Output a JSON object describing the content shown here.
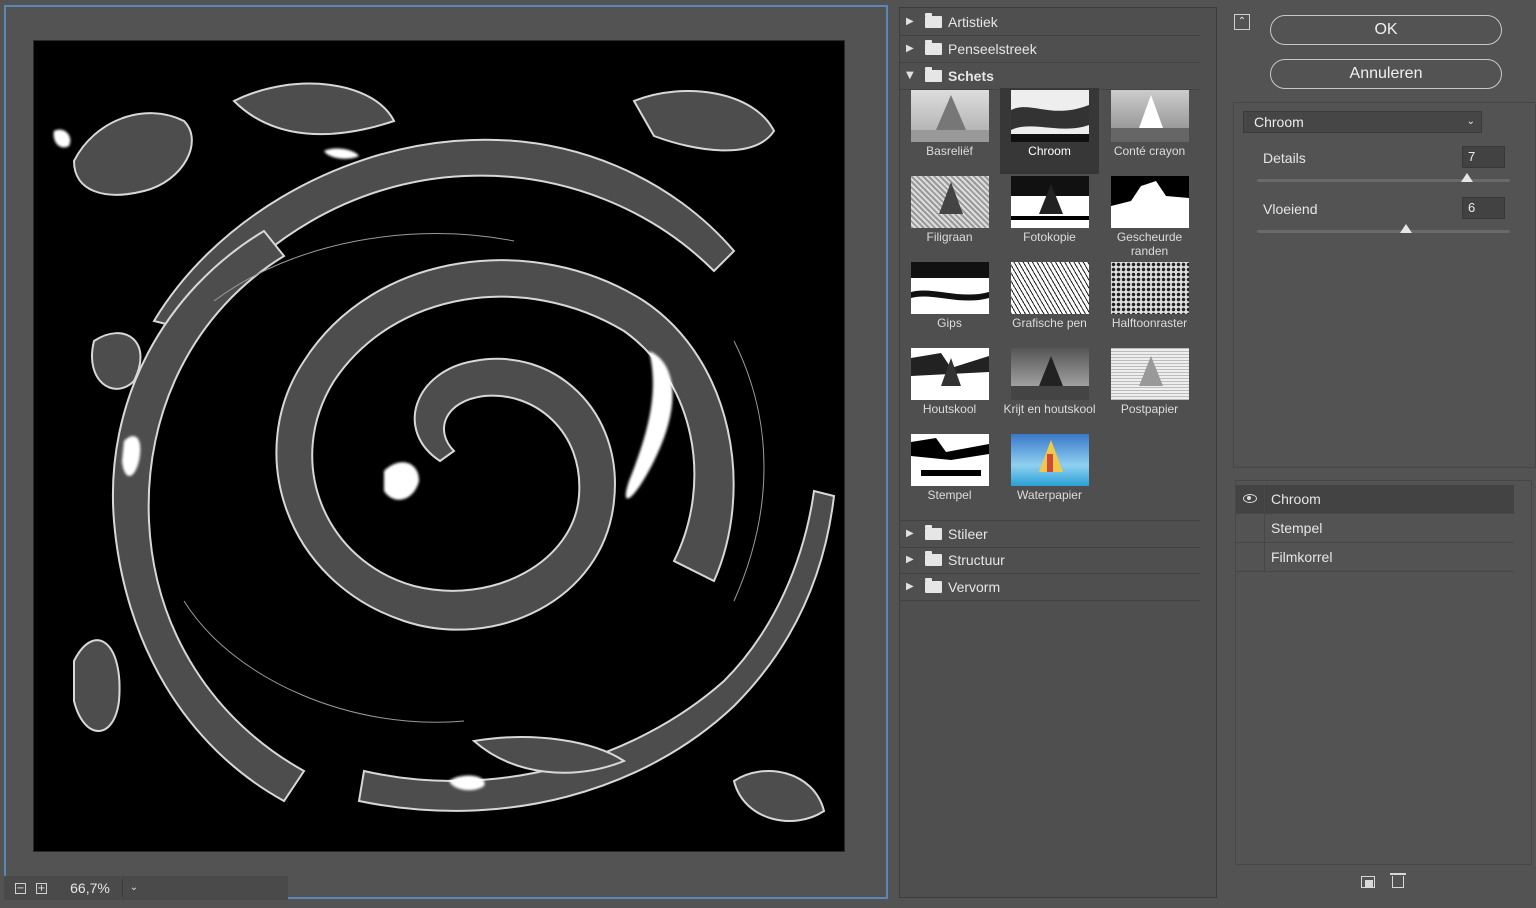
{
  "preview": {
    "zoom_minus": "−",
    "zoom_plus": "+",
    "zoom_value": "66,7%",
    "zoom_dropdown": "⌄"
  },
  "gallery": {
    "folders_top": [
      {
        "label": "Artistiek",
        "arrow": "▶"
      },
      {
        "label": "Penseelstreek",
        "arrow": "▶"
      },
      {
        "label": "Schets",
        "arrow": "▼"
      }
    ],
    "thumbnails": [
      {
        "label": "Basreliëf"
      },
      {
        "label": "Chroom"
      },
      {
        "label": "Conté crayon"
      },
      {
        "label": "Filigraan"
      },
      {
        "label": "Fotokopie"
      },
      {
        "label": "Gescheurde randen"
      },
      {
        "label": "Gips"
      },
      {
        "label": "Grafische pen"
      },
      {
        "label": "Halftoonraster"
      },
      {
        "label": "Houtskool"
      },
      {
        "label": "Krijt en houtskool"
      },
      {
        "label": "Postpapier"
      },
      {
        "label": "Stempel"
      },
      {
        "label": "Waterpapier"
      }
    ],
    "folders_bottom": [
      {
        "label": "Stileer",
        "arrow": "▶"
      },
      {
        "label": "Structuur",
        "arrow": "▶"
      },
      {
        "label": "Vervorm",
        "arrow": "▶"
      }
    ]
  },
  "panel": {
    "collapse_glyph": "⌃",
    "ok_label": "OK",
    "cancel_label": "Annuleren",
    "filter_select": "Chroom",
    "filter_select_chevron": "⌄",
    "params": [
      {
        "label": "Details",
        "value": "7",
        "level": 0.83
      },
      {
        "label": "Vloeiend",
        "value": "6",
        "level": 0.59
      }
    ],
    "layers": [
      {
        "name": "Chroom",
        "visible": true
      },
      {
        "name": "Stempel",
        "visible": false
      },
      {
        "name": "Filmkorrel",
        "visible": false
      }
    ]
  },
  "colors": {
    "panel_bg": "#535353",
    "focus_border": "#5a86b8"
  }
}
